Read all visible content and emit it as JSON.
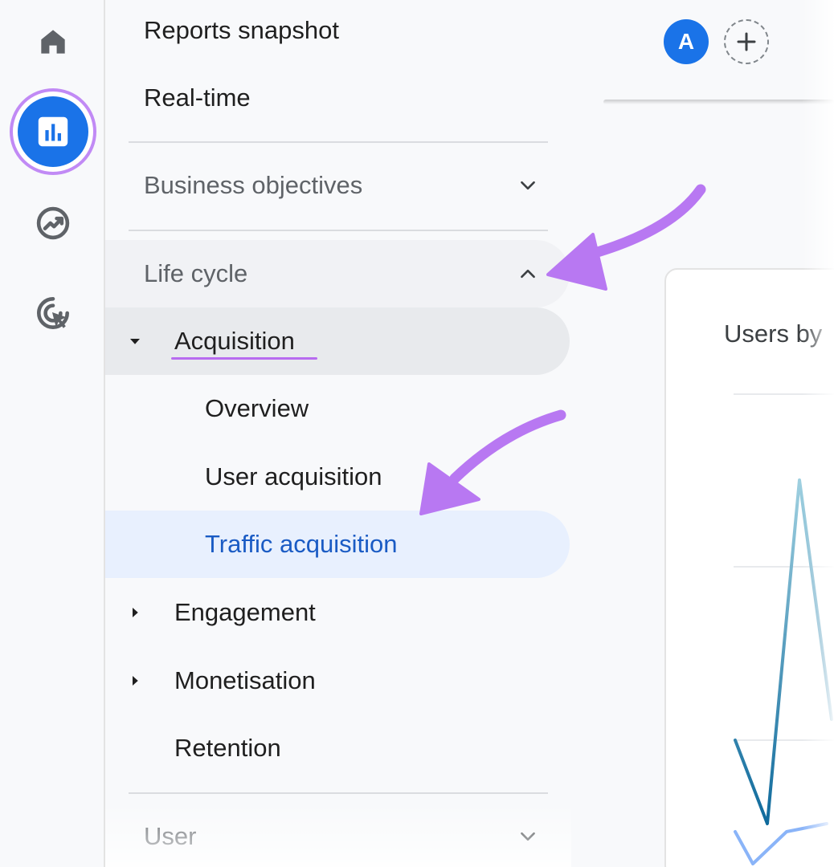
{
  "nav": {
    "reports_snapshot": "Reports snapshot",
    "real_time": "Real-time",
    "business_objectives": "Business objectives",
    "life_cycle": "Life cycle",
    "acquisition": "Acquisition",
    "overview": "Overview",
    "user_acquisition": "User acquisition",
    "traffic_acquisition": "Traffic acquisition",
    "engagement": "Engagement",
    "monetisation": "Monetisation",
    "retention": "Retention",
    "user": "User"
  },
  "header": {
    "avatar_letter": "A"
  },
  "card": {
    "title": "Users by"
  },
  "colors": {
    "accent": "#1a73e8",
    "highlight": "#b86cf0",
    "selected_bg": "#e8f0fe",
    "selected_text": "#1a5bc4",
    "chart_line": "#1f7fa8"
  },
  "icons": {
    "rail": [
      "home-icon",
      "reports-icon",
      "explore-icon",
      "advertising-icon"
    ],
    "header": [
      "add-icon"
    ]
  }
}
